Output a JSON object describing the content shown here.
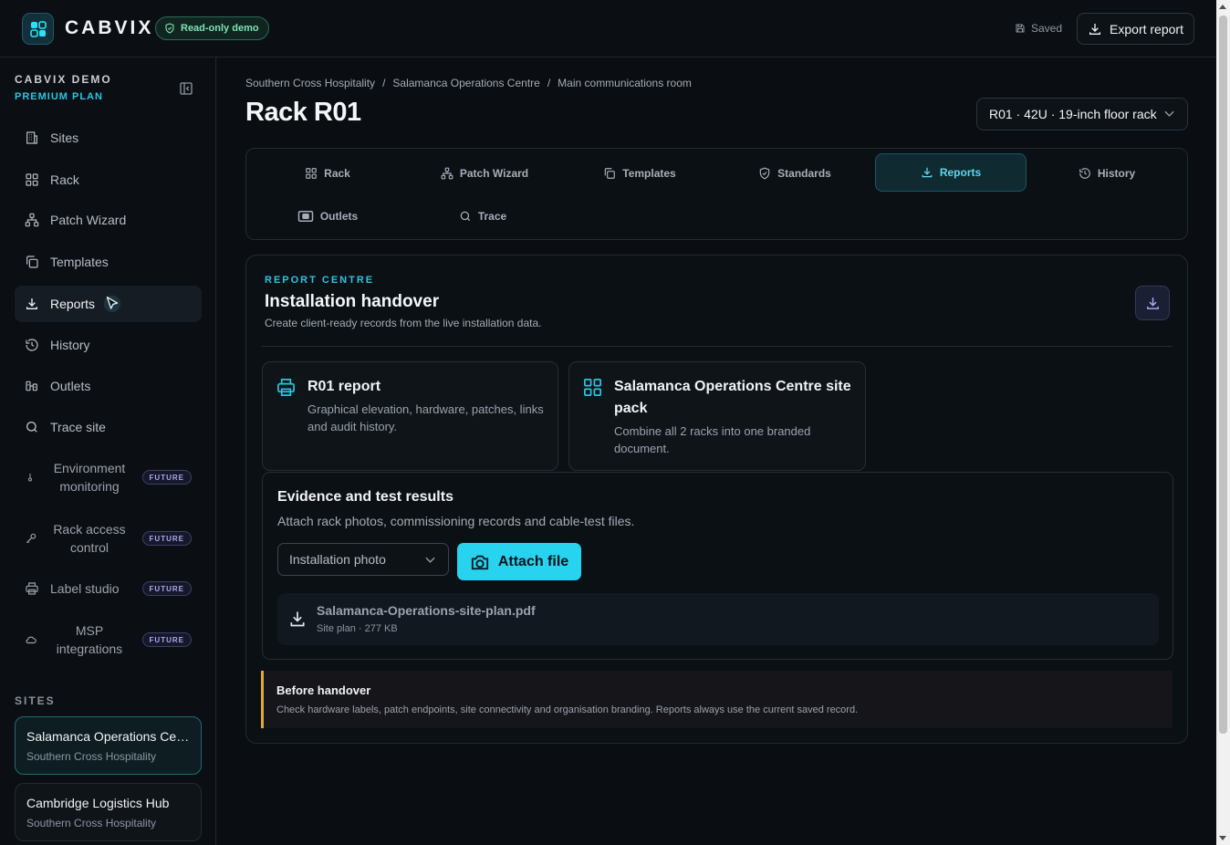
{
  "app": {
    "brand": "CABVIX",
    "demo_badge": "Read-only demo",
    "saved_status": "Saved",
    "export_label": "Export report"
  },
  "sidebar": {
    "org_name": "CABVIX DEMO",
    "plan": "PREMIUM PLAN",
    "items": [
      {
        "label": "Sites",
        "icon": "building-icon"
      },
      {
        "label": "Rack",
        "icon": "grid-icon"
      },
      {
        "label": "Patch Wizard",
        "icon": "network-icon"
      },
      {
        "label": "Templates",
        "icon": "copy-icon"
      },
      {
        "label": "Reports",
        "icon": "download-icon",
        "active": true
      },
      {
        "label": "History",
        "icon": "history-icon"
      },
      {
        "label": "Outlets",
        "icon": "outlet-icon"
      },
      {
        "label": "Trace site",
        "icon": "search-icon"
      }
    ],
    "future_items": [
      {
        "label": "Environment monitoring",
        "badge": "FUTURE",
        "icon": "thermometer-icon"
      },
      {
        "label": "Rack access control",
        "badge": "FUTURE",
        "icon": "key-icon"
      },
      {
        "label": "Label studio",
        "badge": "FUTURE",
        "icon": "printer-icon"
      },
      {
        "label": "MSP integrations",
        "badge": "FUTURE",
        "icon": "cloud-icon"
      }
    ],
    "sites_heading": "SITES",
    "sites": [
      {
        "name": "Salamanca Operations Centre",
        "org": "Southern Cross Hospitality",
        "active": true
      },
      {
        "name": "Cambridge Logistics Hub",
        "org": "Southern Cross Hospitality"
      }
    ]
  },
  "breadcrumb": [
    "Southern Cross Hospitality",
    "/",
    "Salamanca Operations Centre",
    "/",
    "Main communications room"
  ],
  "page": {
    "title": "Rack R01",
    "rack_select": "R01 · 42U · 19-inch floor rack"
  },
  "tabs": [
    {
      "label": "Rack",
      "icon": "grid-icon"
    },
    {
      "label": "Patch Wizard",
      "icon": "network-icon"
    },
    {
      "label": "Templates",
      "icon": "copy-icon"
    },
    {
      "label": "Standards",
      "icon": "shield-icon"
    },
    {
      "label": "Reports",
      "icon": "download-icon",
      "active": true
    },
    {
      "label": "History",
      "icon": "history-icon"
    },
    {
      "label": "Outlets",
      "icon": "outlet-icon"
    },
    {
      "label": "Trace",
      "icon": "search-icon"
    }
  ],
  "report": {
    "section_label": "REPORT CENTRE",
    "title": "Installation handover",
    "description": "Create client-ready records from the live installation data.",
    "cards": [
      {
        "title": "R01 report",
        "description": "Graphical elevation, hardware, patches, links and audit history.",
        "icon": "printer-icon"
      },
      {
        "title": "Salamanca Operations Centre site pack",
        "description": "Combine all 2 racks into one branded document.",
        "icon": "grid-icon"
      }
    ],
    "evidence": {
      "title": "Evidence and test results",
      "description": "Attach rack photos, commissioning records and cable-test files.",
      "type_select": "Installation photo",
      "attach_label": "Attach file",
      "file": {
        "name": "Salamanca-Operations-site-plan.pdf",
        "meta": "Site plan · 277 KB"
      }
    },
    "handover": {
      "title": "Before handover",
      "text": "Check hardware labels, patch endpoints, site connectivity and organisation branding. Reports always use the current saved record."
    }
  },
  "colors": {
    "accent": "#29c4e0",
    "warning": "#e4a43a",
    "success": "#7ee2b4",
    "future": "#a9a7f2"
  }
}
